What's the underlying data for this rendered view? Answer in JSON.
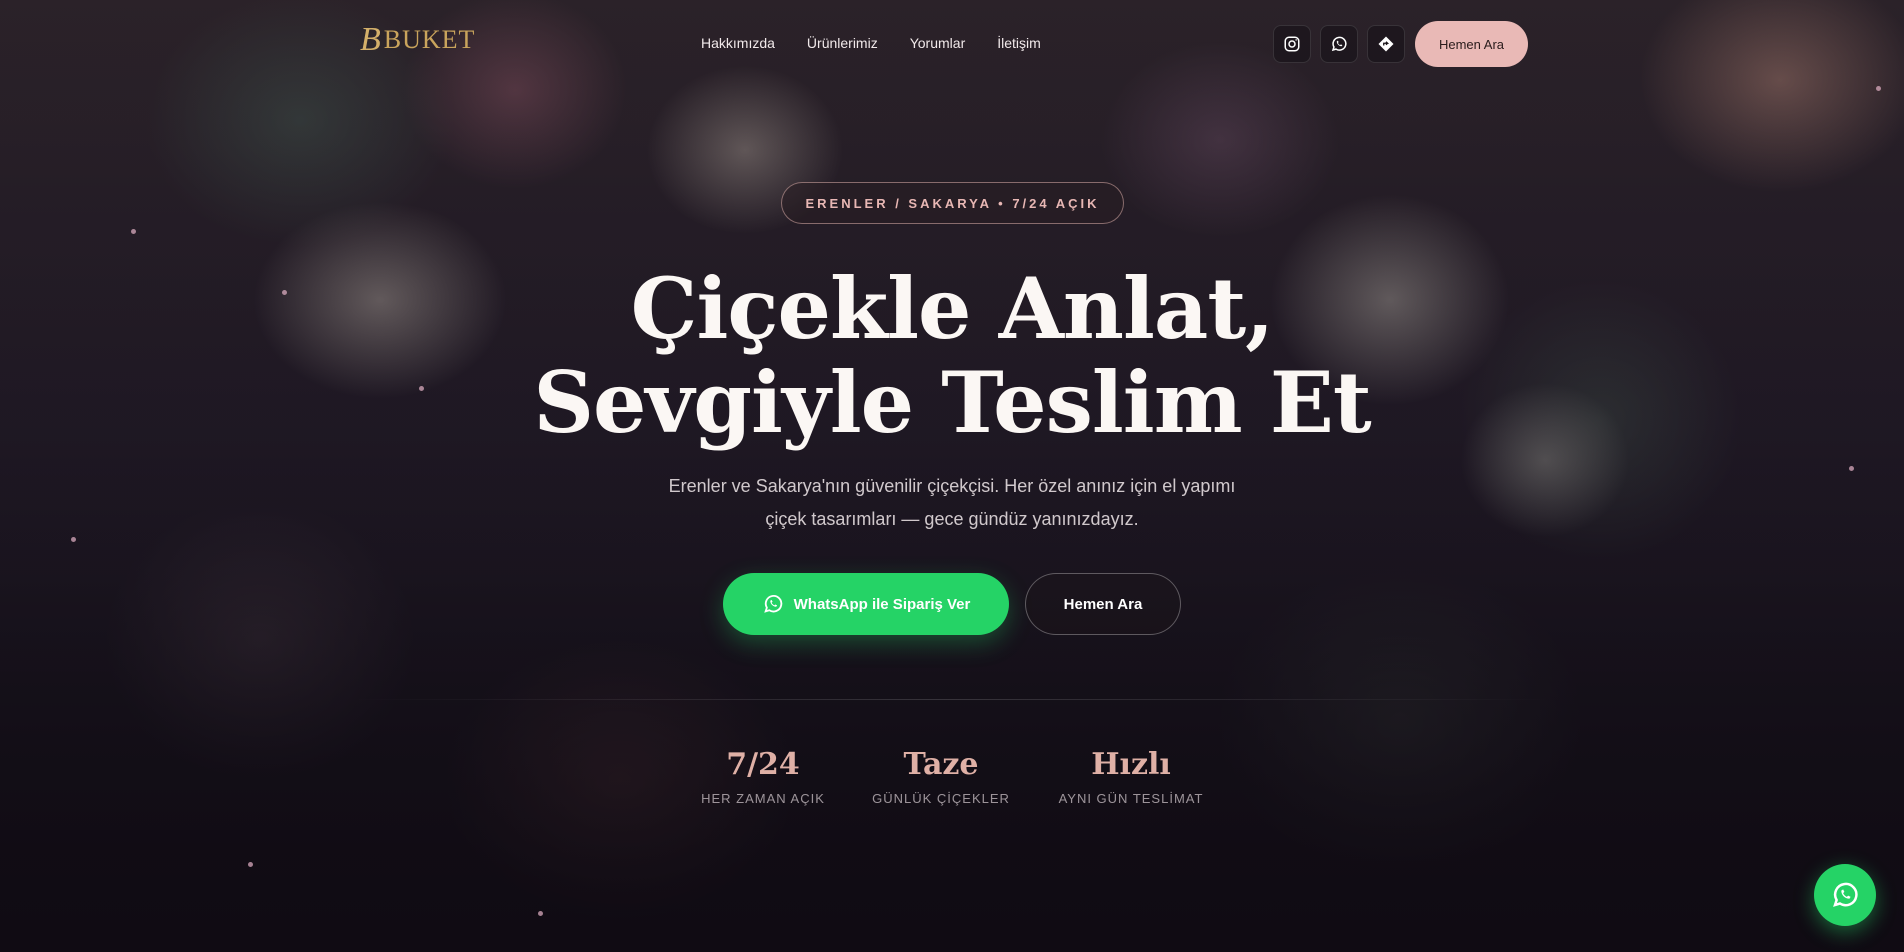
{
  "brand": {
    "logo_mark": "B",
    "logo_text": "BUKET"
  },
  "nav": {
    "items": [
      {
        "label": "Hakkımızda"
      },
      {
        "label": "Ürünlerimiz"
      },
      {
        "label": "Yorumlar"
      },
      {
        "label": "İletişim"
      }
    ]
  },
  "header": {
    "social": [
      {
        "icon": "instagram-icon"
      },
      {
        "icon": "whatsapp-icon"
      },
      {
        "icon": "directions-icon"
      }
    ],
    "call_label": "Hemen Ara"
  },
  "hero": {
    "badge": "ERENLER / SAKARYA • 7/24 AÇIK",
    "title_line1": "Çiçekle Anlat,",
    "title_line2": "Sevgiyle Teslim Et",
    "subtitle": "Erenler ve Sakarya'nın güvenilir çiçekçisi. Her özel anınız için el yapımı çiçek tasarımları — gece gündüz yanınızdayız.",
    "whatsapp_button": "WhatsApp ile Sipariş Ver",
    "call_button": "Hemen Ara"
  },
  "stats": [
    {
      "value": "7/24",
      "label": "HER ZAMAN AÇIK"
    },
    {
      "value": "Taze",
      "label": "GÜNLÜK ÇİÇEKLER"
    },
    {
      "value": "Hızlı",
      "label": "AYNI GÜN TESLİMAT"
    }
  ],
  "colors": {
    "accent_pink": "#e9b9b6",
    "whatsapp_green": "#25d366",
    "logo_gold": "#c9a45c",
    "stat_value": "#dfb0a6"
  }
}
